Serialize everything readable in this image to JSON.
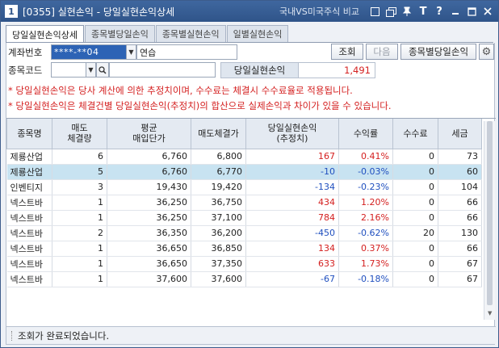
{
  "window": {
    "number": "1",
    "title": "[0355] 실현손익 - 당일실현손익상세",
    "link": "국내VS미국주식 비교",
    "help_glyph": "?",
    "text_glyph": "T"
  },
  "tabs": [
    {
      "label": "당일실현손익상세",
      "active": true
    },
    {
      "label": "종목별당일손익",
      "active": false
    },
    {
      "label": "종목별실현손익",
      "active": false
    },
    {
      "label": "일별실현손익",
      "active": false
    }
  ],
  "form": {
    "account_label": "계좌번호",
    "account_value": "****-**04",
    "account_name": "연습",
    "stock_label": "종목코드",
    "stock_code": "",
    "stock_name": "",
    "query_button": "조회",
    "next_button": "다음",
    "by_stock_button": "종목별당일손익",
    "realized_label": "당일실현손익",
    "realized_value": "1,491"
  },
  "notices": [
    "* 당일실현손익은 당사 계산에 의한 추정치이며, 수수료는 체결시 수수료율로 적용됩니다.",
    "* 당일실현손익은 체결건별 당일실현손익(추정치)의 합산으로 실제손익과 차이가 있을 수 있습니다."
  ],
  "table": {
    "headers": [
      "종목명",
      "매도\n체결량",
      "평균\n매입단가",
      "매도체결가",
      "당일실현손익\n(추정치)",
      "수익률",
      "수수료",
      "세금"
    ],
    "rows": [
      {
        "name": "제룡산업",
        "qty": "6",
        "avg": "6,760",
        "sell": "6,800",
        "pnl": "167",
        "rate": "0.41%",
        "fee": "0",
        "tax": "73",
        "sign": "pos",
        "selected": false
      },
      {
        "name": "제룡산업",
        "qty": "5",
        "avg": "6,760",
        "sell": "6,770",
        "pnl": "-10",
        "rate": "-0.03%",
        "fee": "0",
        "tax": "60",
        "sign": "neg",
        "selected": true
      },
      {
        "name": "인벤티지",
        "qty": "3",
        "avg": "19,430",
        "sell": "19,420",
        "pnl": "-134",
        "rate": "-0.23%",
        "fee": "0",
        "tax": "104",
        "sign": "neg",
        "selected": false
      },
      {
        "name": "넥스트바",
        "qty": "1",
        "avg": "36,250",
        "sell": "36,750",
        "pnl": "434",
        "rate": "1.20%",
        "fee": "0",
        "tax": "66",
        "sign": "pos",
        "selected": false
      },
      {
        "name": "넥스트바",
        "qty": "1",
        "avg": "36,250",
        "sell": "37,100",
        "pnl": "784",
        "rate": "2.16%",
        "fee": "0",
        "tax": "66",
        "sign": "pos",
        "selected": false
      },
      {
        "name": "넥스트바",
        "qty": "2",
        "avg": "36,350",
        "sell": "36,200",
        "pnl": "-450",
        "rate": "-0.62%",
        "fee": "20",
        "tax": "130",
        "sign": "neg",
        "selected": false
      },
      {
        "name": "넥스트바",
        "qty": "1",
        "avg": "36,650",
        "sell": "36,850",
        "pnl": "134",
        "rate": "0.37%",
        "fee": "0",
        "tax": "66",
        "sign": "pos",
        "selected": false
      },
      {
        "name": "넥스트바",
        "qty": "1",
        "avg": "36,650",
        "sell": "37,350",
        "pnl": "633",
        "rate": "1.73%",
        "fee": "0",
        "tax": "67",
        "sign": "pos",
        "selected": false
      },
      {
        "name": "넥스트바",
        "qty": "1",
        "avg": "37,600",
        "sell": "37,600",
        "pnl": "-67",
        "rate": "-0.18%",
        "fee": "0",
        "tax": "67",
        "sign": "neg",
        "selected": false
      }
    ]
  },
  "status": {
    "text": "조회가 완료되었습니다."
  },
  "colors": {
    "positive": "#d42020",
    "negative": "#1f4fbf",
    "selected_row": "#c8e3f1",
    "titlebar": "#2f5489"
  }
}
